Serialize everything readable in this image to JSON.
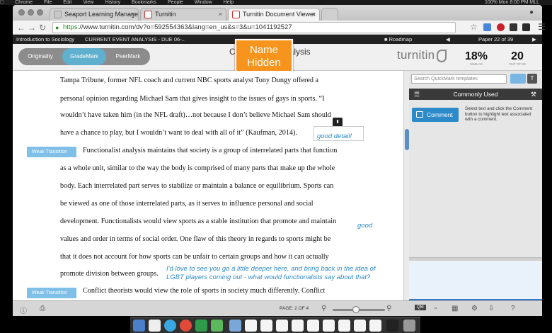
{
  "menubar": {
    "items": [
      "Chrome",
      "File",
      "Edit",
      "View",
      "History",
      "Bookmarks",
      "People",
      "Window",
      "Help"
    ],
    "status": "100% Mon 8:00 PM MLL"
  },
  "browser": {
    "tabs": [
      {
        "label": "Seaport Learning Managem",
        "favicon": "seaport-icon"
      },
      {
        "label": "Turnitin",
        "favicon": "turnitin-icon"
      },
      {
        "label": "Turnitin Document Viewer",
        "favicon": "turnitin-icon"
      }
    ],
    "url_scheme": "https",
    "url_rest": "://www.turnitin.com/dv?o=592554363&lang=en_us&s=3&u=1041192527"
  },
  "turnitin": {
    "nav": {
      "course": "Introduction to Sociology",
      "assignment": "CURRENT EVENT ANALYSIS - DUE 06-..",
      "roadmap": "Roadmap",
      "paper_count": "Paper 22 of 39"
    },
    "modes": [
      "Originality",
      "GradeMark",
      "PeerMark"
    ],
    "active_mode": "GradeMark",
    "doc_title_prefix": "C",
    "doc_title_suffix": "alysis",
    "name_hidden": "Name Hidden",
    "logo": "turnitin",
    "similarity": {
      "value": "18%",
      "label": "SIMILAR"
    },
    "grade": {
      "value": "20",
      "label": "OUT OF 20"
    }
  },
  "document": {
    "lines": [
      "Tampa Tribune, former NFL coach and current NBC sports analyst Tony Dungy offered a",
      "personal opinion regarding Michael Sam that gives insight to the issues of gays in sports.  “I",
      "wouldn’t have taken him (in the NFL draft)…not because I don’t believe Michael Sam should",
      "have a chance to play, but I wouldn’t want to deal with all of it” (Kaufman, 2014).",
      "Functionalist analysis maintains that society is a group of interrelated parts that function",
      "as a whole unit, similar to the way the body is comprised of many parts that make up the whole",
      "body.  Each interrelated part serves to stabilize or maintain a balance or equilibrium.  Sports can",
      "be viewed as one of those interrelated parts, as it serves to influence personal and social",
      "development.  Functionalists would view sports as a stable institution that promote and maintain",
      "values and order in terms of social order.  One flaw of this theory in regards to sports might be",
      "that it does not account for how sports can be unfair to certain groups and how it can actually",
      "promote division between groups.",
      "Conflict theorists would view the role of sports in society much differently.  Conflict"
    ],
    "quickmark_tags": [
      "Weak Transition",
      "Weak Transition"
    ],
    "comments": {
      "c1": "good detail!",
      "c2": "good",
      "c3_line1": "I'd love to see you go a little deeper here, and bring back in the idea of",
      "c3_line2": "LGBT players coming out - what would functionalists say about that?"
    }
  },
  "sidebar": {
    "search_placeholder": "Search QuickMark templates",
    "t_button": "T",
    "set_title": "Commonly Used",
    "comment_button": "Comment",
    "description": "Select text and click the Comment button to highlight text associated with a comment."
  },
  "statusbar": {
    "page": "PAGE:  2 OF 4"
  },
  "colors": {
    "accent": "#2d8ac9",
    "name_badge": "#f7941d",
    "tag": "#7fbfe8"
  }
}
